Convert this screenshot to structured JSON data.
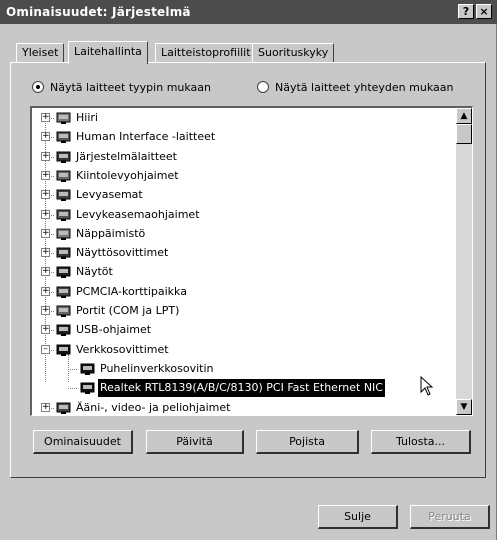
{
  "window": {
    "title": "Ominaisuudet: Järjestelmä",
    "help_label": "?",
    "close_label": "×"
  },
  "tabs": [
    {
      "label": "Yleiset"
    },
    {
      "label": "Laitehallinta"
    },
    {
      "label": "Laitteistoprofiilit"
    },
    {
      "label": "Suorituskyky"
    }
  ],
  "view_options": {
    "by_type": "Näytä laitteet tyypin mukaan",
    "by_connection": "Näytä laitteet yhteyden mukaan",
    "selected": "by_type"
  },
  "tree": [
    {
      "label": "Hiiri",
      "icon": "mouse-icon",
      "level": 0,
      "expander": "+"
    },
    {
      "label": "Human Interface -laitteet",
      "icon": "hid-icon",
      "level": 0,
      "expander": "+"
    },
    {
      "label": "Järjestelmälaitteet",
      "icon": "computer-icon",
      "level": 0,
      "expander": "+"
    },
    {
      "label": "Kiintolevyohjaimet",
      "icon": "disk-controller-icon",
      "level": 0,
      "expander": "+"
    },
    {
      "label": "Levyasemat",
      "icon": "disk-drive-icon",
      "level": 0,
      "expander": "+"
    },
    {
      "label": "Levykeasemaohjaimet",
      "icon": "floppy-controller-icon",
      "level": 0,
      "expander": "+"
    },
    {
      "label": "Näppäimistö",
      "icon": "keyboard-icon",
      "level": 0,
      "expander": "+"
    },
    {
      "label": "Näyttösovittimet",
      "icon": "display-adapter-icon",
      "level": 0,
      "expander": "+"
    },
    {
      "label": "Näytöt",
      "icon": "monitor-icon",
      "level": 0,
      "expander": "+"
    },
    {
      "label": "PCMCIA-korttipaikka",
      "icon": "pcmcia-icon",
      "level": 0,
      "expander": "+"
    },
    {
      "label": "Portit (COM ja LPT)",
      "icon": "port-icon",
      "level": 0,
      "expander": "+"
    },
    {
      "label": "USB-ohjaimet",
      "icon": "usb-icon",
      "level": 0,
      "expander": "+"
    },
    {
      "label": "Verkkosovittimet",
      "icon": "network-adapter-icon",
      "level": 0,
      "expander": "−"
    },
    {
      "label": "Puhelinverkkosovitin",
      "icon": "network-adapter-icon",
      "level": 1
    },
    {
      "label": "Realtek RTL8139(A/B/C/8130) PCI Fast Ethernet NIC",
      "icon": "network-adapter-icon",
      "level": 1,
      "selected": true
    },
    {
      "label": "Ääni-, video- ja peliohjaimet",
      "icon": "sound-icon",
      "level": 0,
      "expander": "+"
    }
  ],
  "buttons": {
    "properties": "Ominaisuudet",
    "refresh": "Päivitä",
    "remove": "Pojista",
    "print": "Tulosta..."
  },
  "footer": {
    "close": "Sulje",
    "cancel": "Peruuta"
  },
  "colors": {
    "titlebar": "#4c4c4c",
    "face": "#c8c8c8",
    "selection": "#000000"
  }
}
